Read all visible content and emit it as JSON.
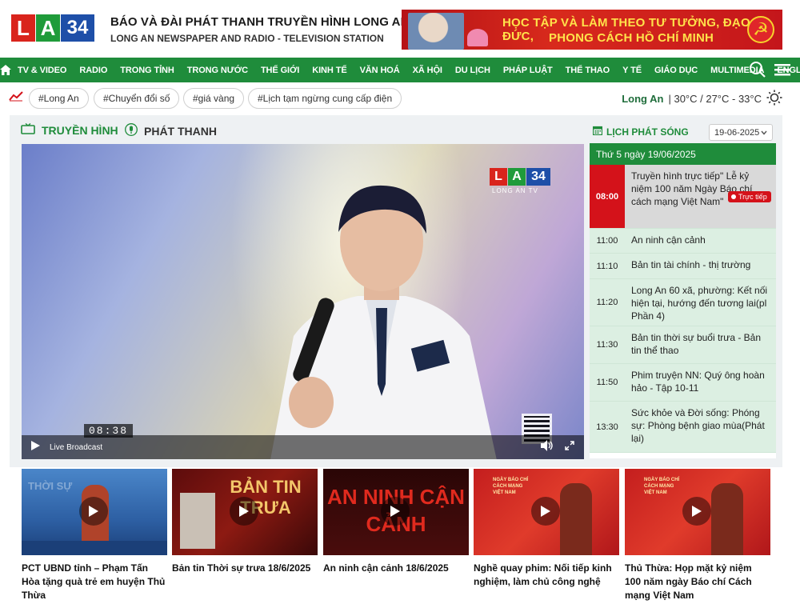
{
  "header": {
    "logo_letters": [
      "L",
      "A",
      "34"
    ],
    "title": "BÁO VÀ ĐÀI PHÁT THANH TRUYỀN HÌNH LONG AN",
    "subtitle": "LONG AN NEWSPAPER AND RADIO - TELEVISION STATION",
    "banner_line1": "HỌC TẬP VÀ LÀM THEO TƯ TƯỞNG, ĐẠO ĐỨC,",
    "banner_line2": "PHONG CÁCH HỒ CHÍ MINH"
  },
  "nav": {
    "items": [
      "TV & VIDEO",
      "RADIO",
      "TRONG TỈNH",
      "TRONG NƯỚC",
      "THẾ GIỚI",
      "KINH TẾ",
      "VĂN HOÁ",
      "XÃ HỘI",
      "DU LỊCH",
      "PHÁP LUẬT",
      "THỂ THAO",
      "Y TẾ",
      "GIÁO DỤC",
      "MULTIMEDIA",
      "ENGLISH"
    ]
  },
  "tags": [
    "#Long An",
    "#Chuyển đổi số",
    "#giá vàng",
    "#Lịch tạm ngừng cung cấp điện"
  ],
  "weather": {
    "city": "Long An",
    "temps": "| 30°C / 27°C - 33°C"
  },
  "media": {
    "tab_tv": "TRUYỀN HÌNH",
    "tab_radio": "PHÁT THANH",
    "schedule_title": "LỊCH PHÁT SÓNG",
    "date_value": "19-06-2025"
  },
  "player": {
    "channel_sub": "LONG AN TV",
    "timestamp": "08:38",
    "live_label": "Live Broadcast"
  },
  "schedule": {
    "day_header": "Thứ 5 ngày 19/06/2025",
    "live_badge": "Trực tiếp",
    "rows": [
      {
        "time": "08:00",
        "program": "Truyền hình trực tiếp\" Lễ kỷ niệm 100 năm Ngày Báo chí cách mạng Việt Nam\""
      },
      {
        "time": "11:00",
        "program": "An ninh cận cảnh"
      },
      {
        "time": "11:10",
        "program": "Bản tin tài chính - thị trường"
      },
      {
        "time": "11:20",
        "program": "Long An 60 xã, phường: Kết nối hiện tại, hướng đến tương lai(pl Phần 4)"
      },
      {
        "time": "11:30",
        "program": "Bản tin thời sự buổi trưa - Bản tin thể thao"
      },
      {
        "time": "11:50",
        "program": "Phim truyện NN: Quý ông hoàn hảo - Tập 10-11"
      },
      {
        "time": "13:30",
        "program": "Sức khỏe và Đời sống: Phóng sự: Phòng bệnh giao mùa(Phát lại)"
      }
    ]
  },
  "news": [
    {
      "title": "PCT UBND tỉnh – Phạm Tấn Hòa tặng quà trẻ em huyện Thủ Thừa",
      "thumb_text": "THỜI SỰ"
    },
    {
      "title": "Bản tin Thời sự trưa 18/6/2025",
      "thumb_text": "BẢN TIN TRƯA"
    },
    {
      "title": "An ninh cận cảnh 18/6/2025",
      "thumb_text": "AN NINH CẬN CẢNH"
    },
    {
      "title": "Nghề quay phim: Nối tiếp kinh nghiệm, làm chủ công nghệ",
      "thumb_text": "NGÀY BÁO CHÍ CÁCH MẠNG VIỆT NAM"
    },
    {
      "title": "Thủ Thừa: Họp mặt kỷ niệm 100 năm ngày Báo chí Cách mạng Việt Nam",
      "thumb_text": "NGÀY BÁO CHÍ CÁCH MẠNG VIỆT NAM"
    }
  ],
  "colors": {
    "brand_green": "#1f8c3b",
    "live_red": "#d4121a",
    "logo_red": "#d9241c",
    "logo_blue": "#1e4fa8"
  }
}
